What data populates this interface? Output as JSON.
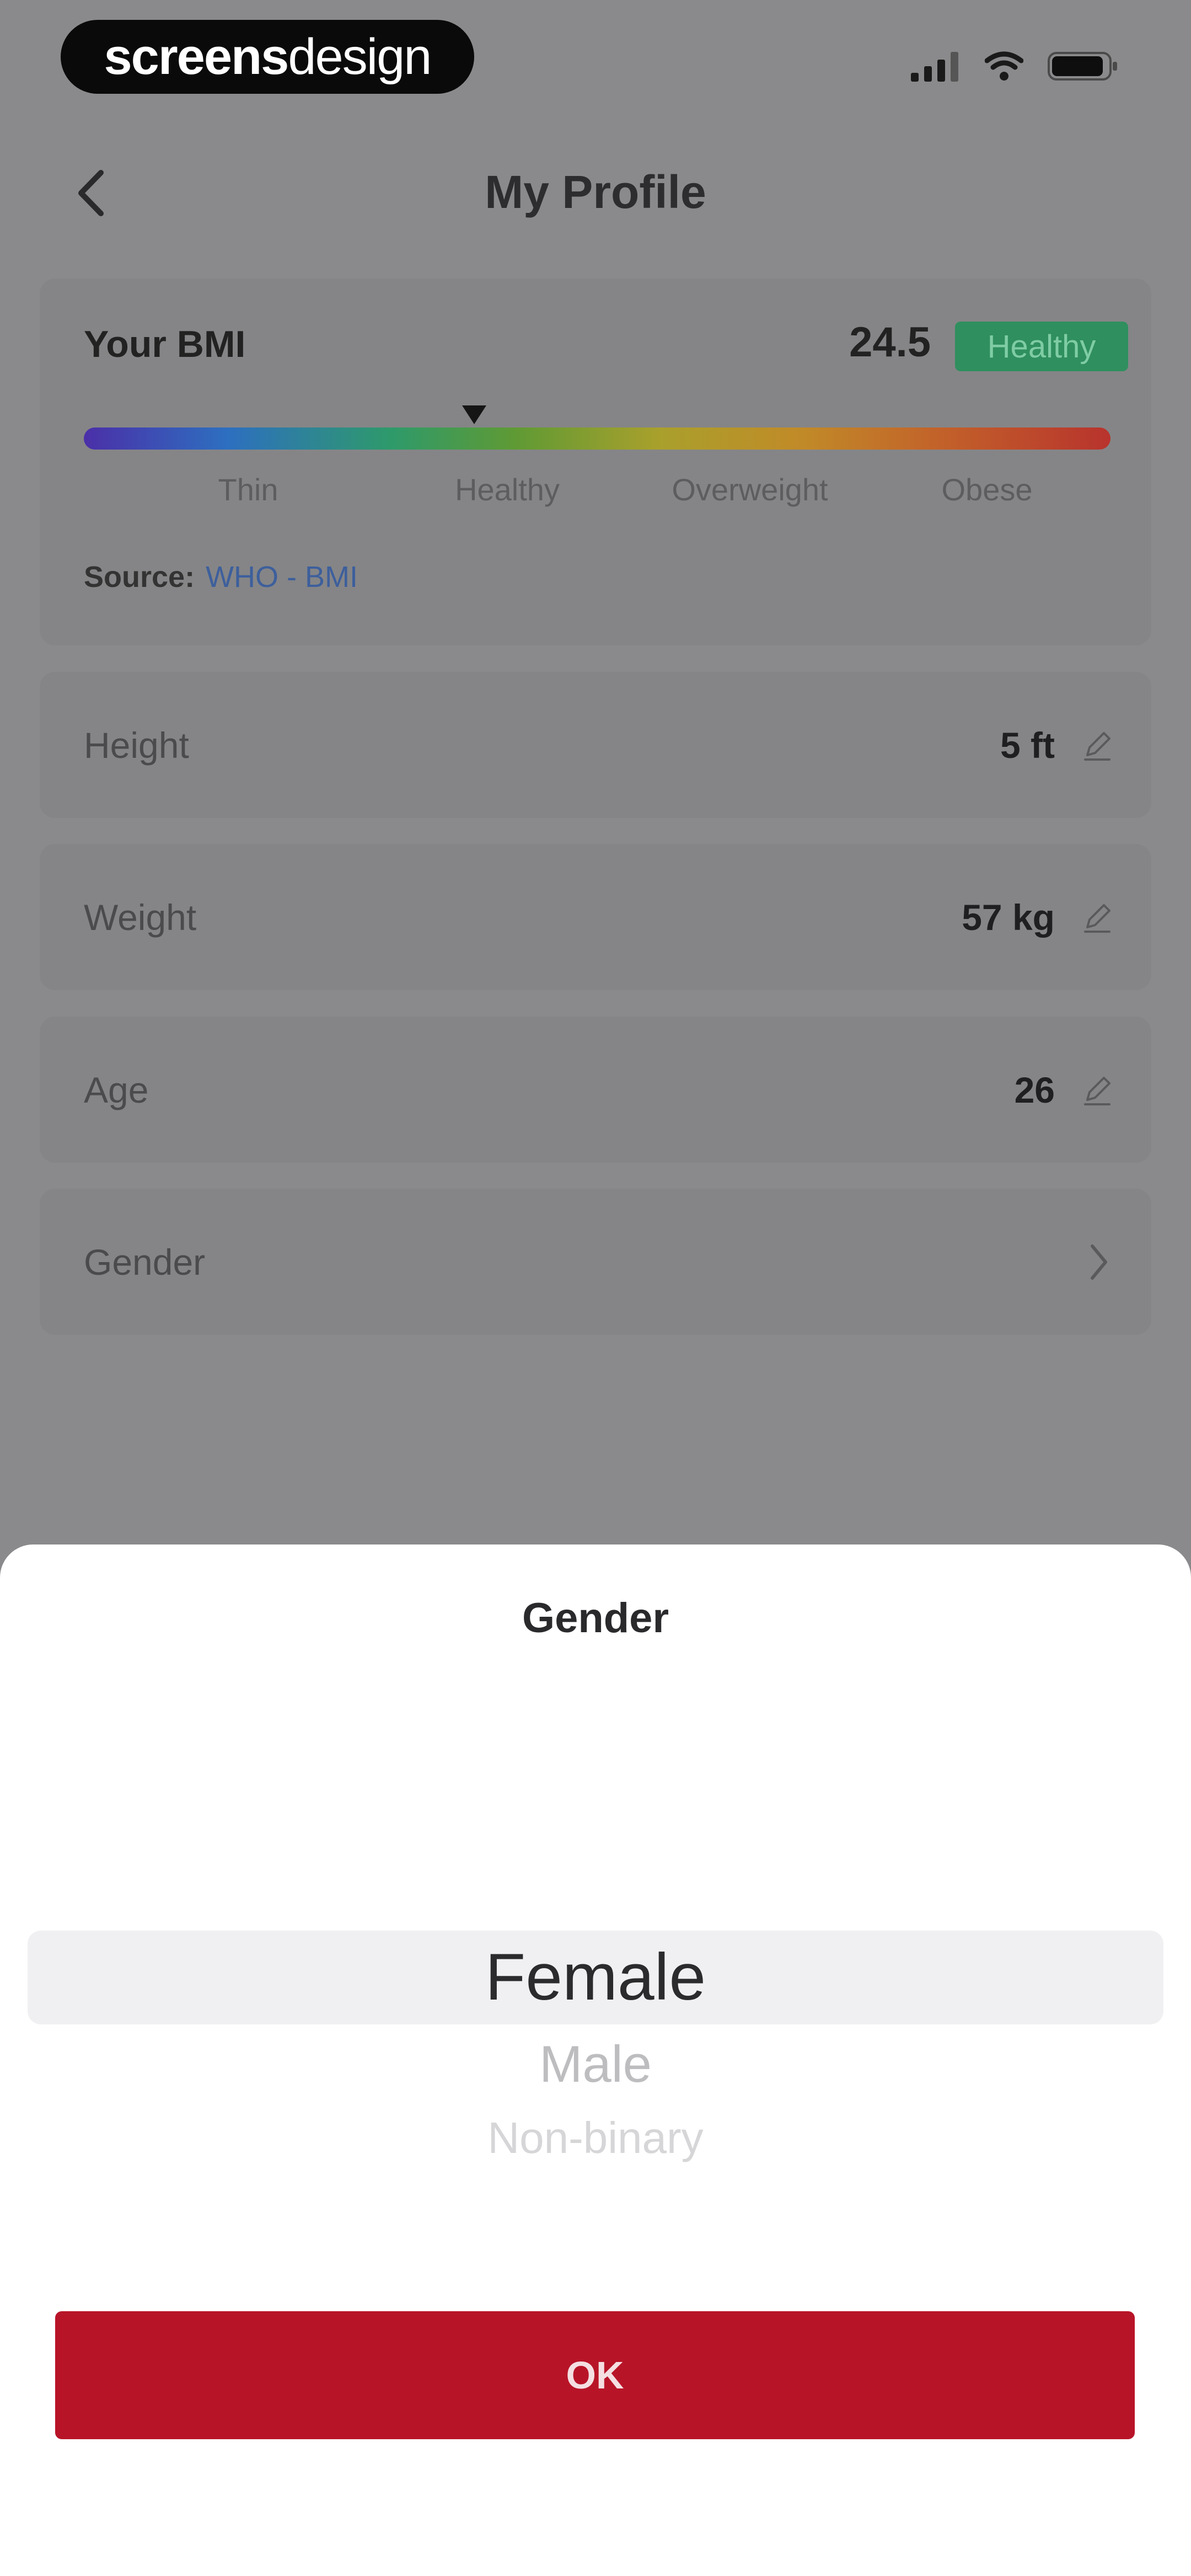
{
  "status_bar": {
    "brand_bold": "screens",
    "brand_light": "design",
    "icons": [
      "signal-icon",
      "wifi-icon",
      "battery-icon"
    ]
  },
  "header": {
    "title": "My Profile",
    "back_icon": "chevron-left-icon"
  },
  "bmi": {
    "label": "Your BMI",
    "value": "24.5",
    "status": "Healthy",
    "categories": [
      "Thin",
      "Healthy",
      "Overweight",
      "Obese"
    ],
    "marker_fraction": 0.38,
    "source_label": "Source:",
    "source_link": "WHO - BMI",
    "colors": {
      "badge": "#2f8f5e",
      "scale_start": "#4b2fa8",
      "scale_end": "#b8332d"
    }
  },
  "profile_rows": [
    {
      "label": "Height",
      "value": "5 ft",
      "icon": "pencil-icon"
    },
    {
      "label": "Weight",
      "value": "57 kg",
      "icon": "pencil-icon"
    },
    {
      "label": "Age",
      "value": "26",
      "icon": "pencil-icon"
    },
    {
      "label": "Gender",
      "value": "",
      "icon": "chevron-right-icon"
    }
  ],
  "gender_sheet": {
    "title": "Gender",
    "options": [
      "Female",
      "Male",
      "Non-binary"
    ],
    "selected": "Female",
    "ok_label": "OK",
    "colors": {
      "ok_button": "#b81428"
    }
  }
}
